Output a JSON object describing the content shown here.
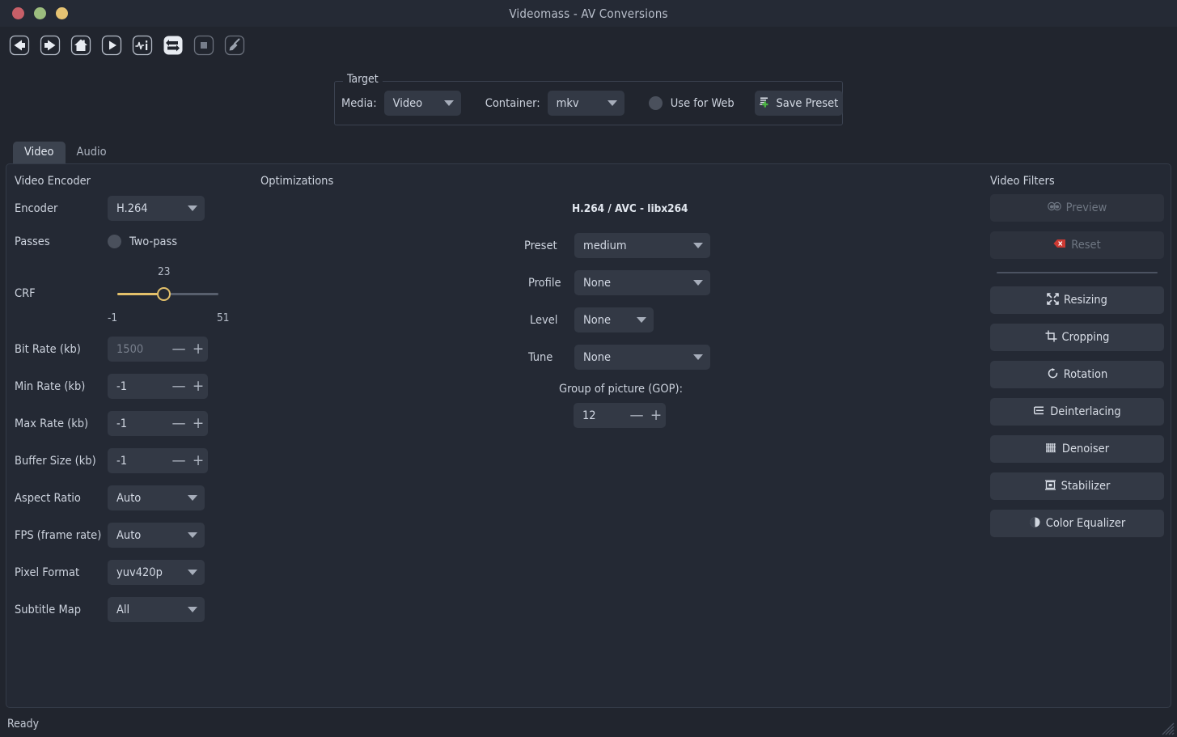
{
  "window": {
    "title": "Videomass - AV Conversions",
    "traffic_lights": [
      "close-button",
      "minimize-button",
      "maximize-button"
    ]
  },
  "toolbar": {
    "buttons": [
      {
        "name": "back-icon",
        "label": "Back"
      },
      {
        "name": "forward-icon",
        "label": "Forward"
      },
      {
        "name": "home-icon",
        "label": "Home"
      },
      {
        "name": "play-icon",
        "label": "Play"
      },
      {
        "name": "media-info-icon",
        "label": "Media Info"
      },
      {
        "name": "convert-icon",
        "label": "Start Conversion"
      },
      {
        "name": "stop-icon",
        "label": "Stop"
      },
      {
        "name": "clear-icon",
        "label": "Clear"
      }
    ]
  },
  "target": {
    "legend": "Target",
    "media_label": "Media:",
    "media_value": "Video",
    "container_label": "Container:",
    "container_value": "mkv",
    "use_for_web_label": "Use for Web",
    "save_preset_label": "Save Preset"
  },
  "tabs": [
    {
      "label": "Video",
      "active": true
    },
    {
      "label": "Audio",
      "active": false
    }
  ],
  "video_encoder": {
    "title": "Video Encoder",
    "encoder_label": "Encoder",
    "encoder_value": "H.264",
    "passes_label": "Passes",
    "two_pass_label": "Two-pass",
    "crf_label": "CRF",
    "crf_value": "23",
    "crf_min": "-1",
    "crf_max": "51",
    "fields": [
      {
        "label": "Bit Rate (kb)",
        "value": "1500",
        "dim": true
      },
      {
        "label": "Min Rate (kb)",
        "value": "-1",
        "dim": false
      },
      {
        "label": "Max Rate (kb)",
        "value": "-1",
        "dim": false
      },
      {
        "label": "Buffer Size (kb)",
        "value": "-1",
        "dim": false
      }
    ],
    "selects": [
      {
        "label": "Aspect Ratio",
        "value": "Auto"
      },
      {
        "label": "FPS (frame rate)",
        "value": "Auto"
      },
      {
        "label": "Pixel Format",
        "value": "yuv420p"
      },
      {
        "label": "Subtitle Map",
        "value": "All"
      }
    ],
    "minus_glyph": "—",
    "plus_glyph": "+"
  },
  "optimizations": {
    "title": "Optimizations",
    "codec_label": "H.264 / AVC - libx264",
    "preset_label": "Preset",
    "preset_value": "medium",
    "profile_label": "Profile",
    "profile_value": "None",
    "level_label": "Level",
    "level_value": "None",
    "tune_label": "Tune",
    "tune_value": "None",
    "gop_label": "Group of picture (GOP):",
    "gop_value": "12"
  },
  "video_filters": {
    "title": "Video Filters",
    "buttons": [
      {
        "label": "Preview",
        "icon": "eyes-icon",
        "disabled": true
      },
      {
        "label": "Reset",
        "icon": "reset-icon",
        "disabled": true
      },
      {
        "label": "Resizing",
        "icon": "resize-icon",
        "disabled": false
      },
      {
        "label": "Cropping",
        "icon": "crop-icon",
        "disabled": false
      },
      {
        "label": "Rotation",
        "icon": "rotate-icon",
        "disabled": false
      },
      {
        "label": "Deinterlacing",
        "icon": "deinterlace-icon",
        "disabled": false
      },
      {
        "label": "Denoiser",
        "icon": "denoise-icon",
        "disabled": false
      },
      {
        "label": "Stabilizer",
        "icon": "stabilize-icon",
        "disabled": false
      },
      {
        "label": "Color Equalizer",
        "icon": "color-equalizer-icon",
        "disabled": false
      }
    ]
  },
  "statusbar": {
    "text": "Ready"
  },
  "colors": {
    "background": "#21252e",
    "panel": "#242934",
    "control": "#333945",
    "accent_slider": "#e3c06a",
    "text": "#ccd2dd",
    "green": "#4bb543",
    "red": "#cc3a33"
  }
}
